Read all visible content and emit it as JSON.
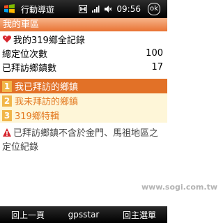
{
  "status_bar": {
    "app_title": "行動導遊",
    "time": "09:56",
    "icons": [
      "h-data-icon",
      "signal-icon",
      "no-sound-icon",
      "ok-icon"
    ]
  },
  "section": {
    "title": "我的車區"
  },
  "info": {
    "record_title": "我的319鄉全記錄",
    "total_label": "總定位次數",
    "total_value": "100",
    "visited_label": "已拜訪鄉鎮數",
    "visited_value": "17"
  },
  "menu": {
    "items": [
      {
        "num": "1",
        "label": "我已拜訪的鄉鎮",
        "selected": true
      },
      {
        "num": "2",
        "label": "我未拜訪的鄉鎮",
        "selected": false
      },
      {
        "num": "3",
        "label": "319鄉特輯",
        "selected": false
      }
    ]
  },
  "note": {
    "text": "已拜訪鄉鎮不含於金門、馬祖地區之定位紀錄"
  },
  "watermark": {
    "text": "www.sogi.com.tw"
  },
  "softkeys": {
    "left": "回上一頁",
    "center": "gpsstar",
    "right": "回主選單"
  },
  "colors": {
    "accent": "#e27127",
    "menu_bg": "#fef6d8",
    "badge": "#f1b64a"
  }
}
